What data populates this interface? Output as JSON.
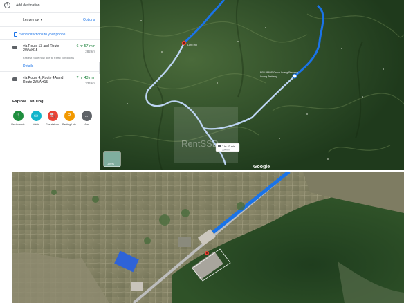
{
  "panel": {
    "add_destination": "Add destination",
    "leave_now": "Leave now",
    "options": "Options",
    "send_directions": "Send directions to your phone",
    "routes": [
      {
        "title": "via Route 13 and Route 2W/AH15",
        "time": "6 hr 57 min",
        "distance": "282 km",
        "note": "Fastest route now due to traffic conditions",
        "details": "Details"
      },
      {
        "title": "via Route 4, Route 4A and Route 2W/AH15",
        "time": "7 hr 43 min",
        "distance": "334 km"
      }
    ],
    "explore_title": "Explore Lan Ting",
    "categories": [
      {
        "label": "Restaurants",
        "icon": "fork-knife-icon",
        "color": "#1e8e3e",
        "glyph": "🍴"
      },
      {
        "label": "Hotels",
        "icon": "bed-icon",
        "color": "#12b5cb",
        "glyph": "▭"
      },
      {
        "label": "Gas stations",
        "icon": "gas-pump-icon",
        "color": "#ea4335",
        "glyph": "⛽"
      },
      {
        "label": "Parking Lots",
        "icon": "parking-icon",
        "color": "#f29900",
        "glyph": "P"
      },
      {
        "label": "More",
        "icon": "more-icon",
        "color": "#5f6368",
        "glyph": "•••"
      }
    ]
  },
  "top_map": {
    "origin_label": "Lan Ting",
    "destination_label": "Luang Prabang",
    "destination_name": "BPJ BMOS Group Luang Prabang",
    "route_bubble": "7 hr 43 min",
    "route_bubble_sub": "334 km",
    "layers_label": "Layers",
    "brand": "Google",
    "watermark": "RentSSD",
    "route_color": "#1a73e8",
    "alt_route_color": "#bcd4f2"
  }
}
